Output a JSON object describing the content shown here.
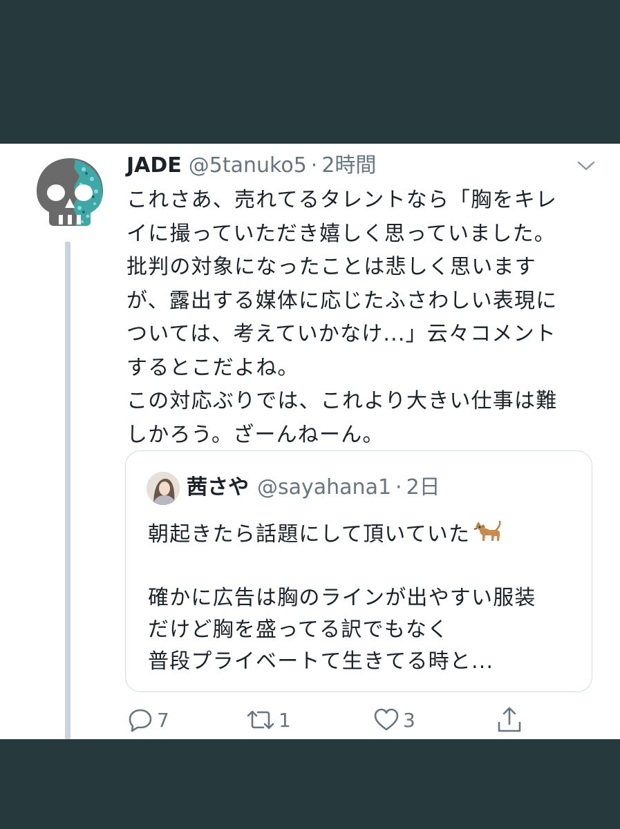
{
  "tweet": {
    "author_name": "JADE",
    "handle": "@5tanuko5",
    "separator": "·",
    "time": "2時間",
    "icons": {
      "avatar": "skull-avatar-icon",
      "menu": "chevron-down-icon"
    },
    "body_lines": [
      "これさあ、売れてるタレントなら「胸をキレ",
      "イに撮っていただき嬉しく思っていました。",
      "批判の対象になったことは悲しく思います",
      "が、露出する媒体に応じたふさわしい表現に",
      "ついては、考えていかなけ...」云々コメント",
      "するとこだよね。",
      "この対応ぶりでは、これより大きい仕事は難",
      "しかろう。ざーんねーん。"
    ]
  },
  "quoted": {
    "author_name": "茜さや",
    "handle": "@sayahana1",
    "separator": "·",
    "time": "2日",
    "line1": "朝起きたら話題にして頂いていた",
    "emoji": "dog-emoji-icon",
    "line2": "",
    "line3": "確かに広告は胸のラインが出やすい服装",
    "line4": "だけど胸を盛ってる訳でもなく",
    "line5": "普段プライベートて生きてる時と..."
  },
  "actions": {
    "reply_count": "7",
    "retweet_count": "1",
    "like_count": "3",
    "icons": [
      "reply-icon",
      "retweet-icon",
      "like-icon",
      "share-icon"
    ]
  },
  "colors": {
    "background_band": "#263a3d",
    "text": "#1c2229",
    "secondary_text": "#66757f",
    "thread_line": "#c9d3dc",
    "quote_border": "#d3dbe2"
  }
}
